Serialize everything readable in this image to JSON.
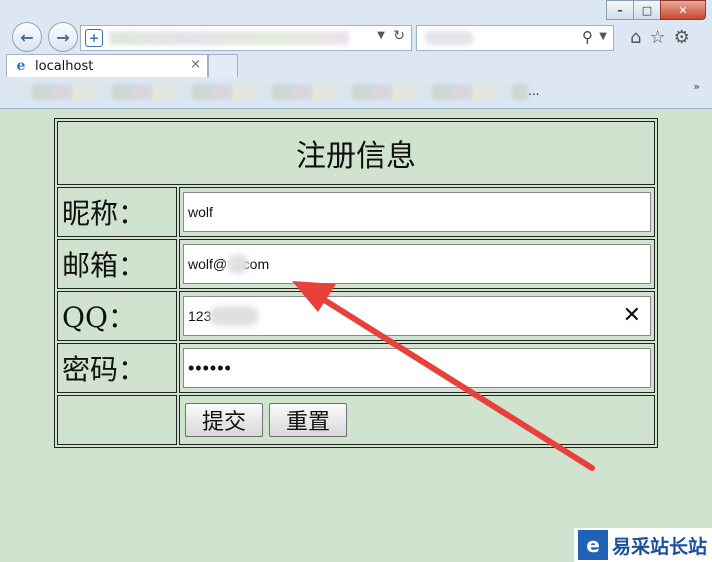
{
  "browser": {
    "tab_title": "localhost",
    "tab_close": "×",
    "address_icon": "ie-page-icon",
    "favorites_ellipsis": "...",
    "favorites_more": "»",
    "window_buttons": {
      "minimize": "–",
      "maximize": "□",
      "close": "✕"
    }
  },
  "form": {
    "title": "注册信息",
    "nickname_label": "昵称：",
    "nickname_value": "wolf",
    "email_label": "邮箱：",
    "email_value": "wolf@    com",
    "qq_label": "QQ：",
    "qq_value": "123        0",
    "qq_clear": "✕",
    "password_label": "密码：",
    "password_value": "••••••",
    "submit_label": "提交",
    "reset_label": "重置"
  },
  "watermark": {
    "text": "易采站长站"
  },
  "colors": {
    "page_bg": "#cfe3cf",
    "arrow": "#e8403a"
  }
}
